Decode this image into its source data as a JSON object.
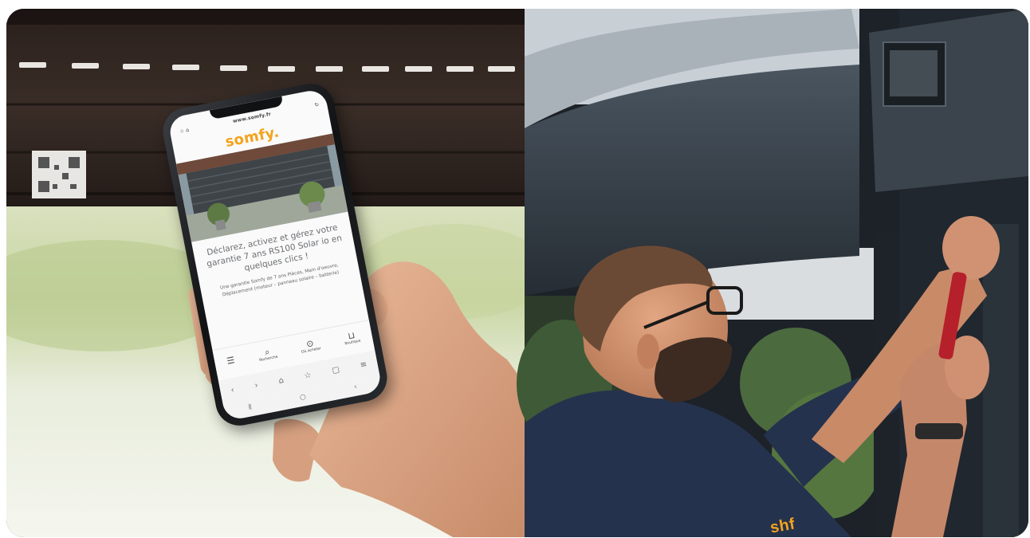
{
  "phone": {
    "url": "www.somfy.fr",
    "logo": "somfy.",
    "headline": "Déclarez, activez et gérez votre garantie 7 ans RS100 Solar io en quelques clics !",
    "body": "Une garantie Somfy de 7 ans Pièces, Main d'oeuvre, Déplacement (moteur – panneau solaire – batterie)",
    "nav": [
      {
        "icon": "menu-icon",
        "glyph": "☰",
        "label": ""
      },
      {
        "icon": "search-icon",
        "glyph": "⌕",
        "label": "Recherche"
      },
      {
        "icon": "location-pin-icon",
        "glyph": "⊙",
        "label": "Où acheter"
      },
      {
        "icon": "cart-icon",
        "glyph": "⊔",
        "label": "Boutique"
      }
    ],
    "browser_buttons": [
      "‹",
      "›",
      "⌂",
      "☆",
      "▢",
      "≡"
    ],
    "system_buttons": [
      "⦀",
      "○",
      "‹"
    ]
  },
  "shirt_logo": "shf",
  "colors": {
    "brand_orange": "#f4a31c",
    "shirt_navy": "#24324d"
  }
}
